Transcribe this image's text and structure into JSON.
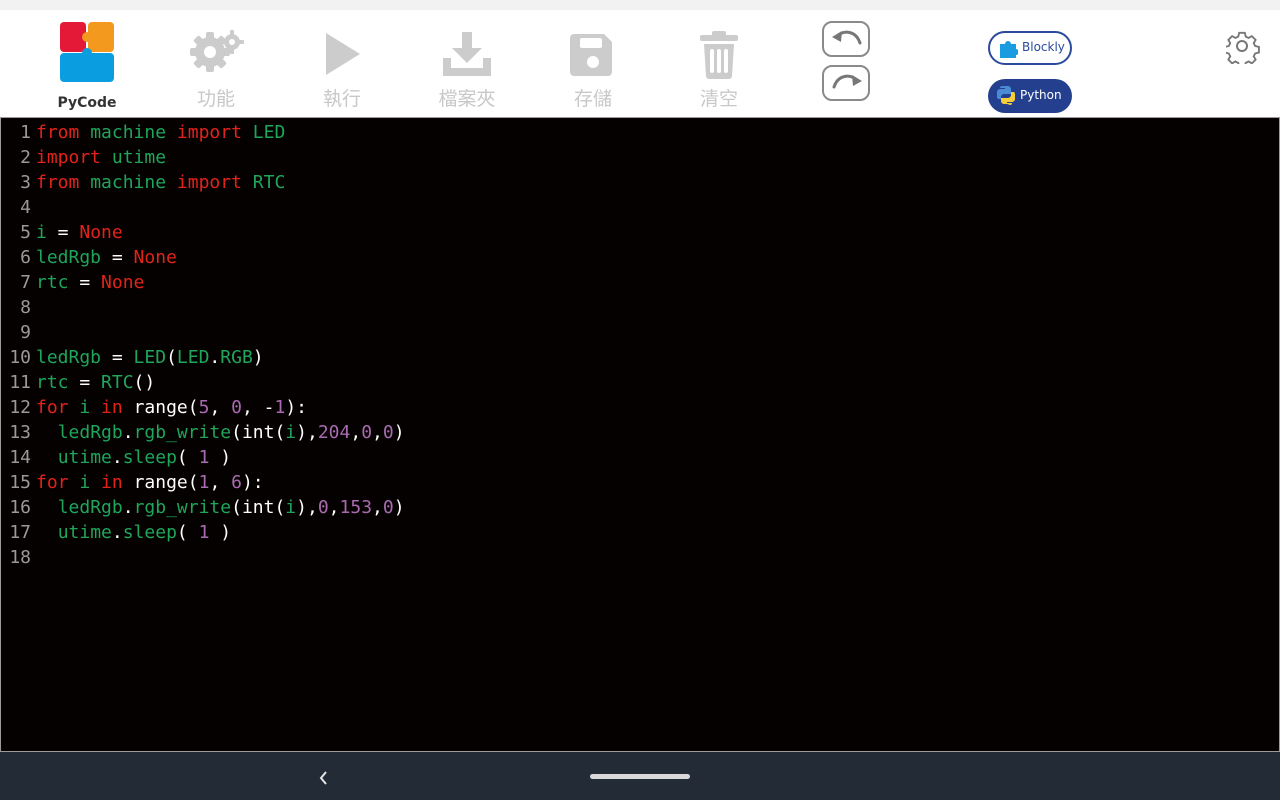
{
  "app": {
    "name": "PyCode"
  },
  "toolbar": {
    "tools": [
      {
        "label": "功能",
        "icon": "gear-icon"
      },
      {
        "label": "執行",
        "icon": "play-icon"
      },
      {
        "label": "檔案夾",
        "icon": "download-icon"
      },
      {
        "label": "存儲",
        "icon": "save-icon"
      },
      {
        "label": "清空",
        "icon": "trash-icon"
      }
    ],
    "undo_icon": "undo-icon",
    "redo_icon": "redo-icon",
    "modes": {
      "blockly_label": "Blockly",
      "python_label": "Python",
      "active": "Python"
    },
    "settings_icon": "gear-outline-icon"
  },
  "colors": {
    "editor_background": "#060101",
    "keyword": "#e2231a",
    "identifier": "#1ea65a",
    "number": "#a86ab0",
    "plain": "#ffffff",
    "line_number": "#9a9a9a",
    "mode_active": "#253f8f",
    "tool_disabled": "#c8c8c8"
  },
  "editor": {
    "lines": [
      {
        "n": "1",
        "tokens": [
          [
            "from",
            "kw"
          ],
          [
            " ",
            ""
          ],
          [
            "machine",
            "id"
          ],
          [
            " ",
            ""
          ],
          [
            "import",
            "kw"
          ],
          [
            " ",
            ""
          ],
          [
            "LED",
            "id"
          ]
        ]
      },
      {
        "n": "2",
        "tokens": [
          [
            "import",
            "kw"
          ],
          [
            " ",
            ""
          ],
          [
            "utime",
            "id"
          ]
        ]
      },
      {
        "n": "3",
        "tokens": [
          [
            "from",
            "kw"
          ],
          [
            " ",
            ""
          ],
          [
            "machine",
            "id"
          ],
          [
            " ",
            ""
          ],
          [
            "import",
            "kw"
          ],
          [
            " ",
            ""
          ],
          [
            "RTC",
            "id"
          ]
        ]
      },
      {
        "n": "4",
        "tokens": []
      },
      {
        "n": "5",
        "tokens": [
          [
            "i",
            "id"
          ],
          [
            " = ",
            ""
          ],
          [
            "None",
            "kw"
          ]
        ]
      },
      {
        "n": "6",
        "tokens": [
          [
            "ledRgb",
            "id"
          ],
          [
            " = ",
            ""
          ],
          [
            "None",
            "kw"
          ]
        ]
      },
      {
        "n": "7",
        "tokens": [
          [
            "rtc",
            "id"
          ],
          [
            " = ",
            ""
          ],
          [
            "None",
            "kw"
          ]
        ]
      },
      {
        "n": "8",
        "tokens": []
      },
      {
        "n": "9",
        "tokens": []
      },
      {
        "n": "10",
        "tokens": [
          [
            "ledRgb",
            "id"
          ],
          [
            " = ",
            ""
          ],
          [
            "LED",
            "id"
          ],
          [
            "(",
            ""
          ],
          [
            "LED",
            "id"
          ],
          [
            ".",
            ""
          ],
          [
            "RGB",
            "id"
          ],
          [
            ")",
            ""
          ]
        ]
      },
      {
        "n": "11",
        "tokens": [
          [
            "rtc",
            "id"
          ],
          [
            " = ",
            ""
          ],
          [
            "RTC",
            "id"
          ],
          [
            "()",
            ""
          ]
        ]
      },
      {
        "n": "12",
        "tokens": [
          [
            "for",
            "kw"
          ],
          [
            " ",
            ""
          ],
          [
            "i",
            "id"
          ],
          [
            " ",
            ""
          ],
          [
            "in",
            "kw"
          ],
          [
            " range(",
            ""
          ],
          [
            "5",
            "num"
          ],
          [
            ", ",
            ""
          ],
          [
            "0",
            "num"
          ],
          [
            ", -",
            ""
          ],
          [
            "1",
            "num"
          ],
          [
            "):",
            ""
          ]
        ]
      },
      {
        "n": "13",
        "tokens": [
          [
            "  ",
            ""
          ],
          [
            "ledRgb",
            "id"
          ],
          [
            ".",
            ""
          ],
          [
            "rgb_write",
            "id"
          ],
          [
            "(int(",
            ""
          ],
          [
            "i",
            "id"
          ],
          [
            "),",
            ""
          ],
          [
            "204",
            "num"
          ],
          [
            ",",
            ""
          ],
          [
            "0",
            "num"
          ],
          [
            ",",
            ""
          ],
          [
            "0",
            "num"
          ],
          [
            ")",
            ""
          ]
        ]
      },
      {
        "n": "14",
        "tokens": [
          [
            "  ",
            ""
          ],
          [
            "utime",
            "id"
          ],
          [
            ".",
            ""
          ],
          [
            "sleep",
            "id"
          ],
          [
            "( ",
            ""
          ],
          [
            "1",
            "num"
          ],
          [
            " )",
            ""
          ]
        ]
      },
      {
        "n": "15",
        "tokens": [
          [
            "for",
            "kw"
          ],
          [
            " ",
            ""
          ],
          [
            "i",
            "id"
          ],
          [
            " ",
            ""
          ],
          [
            "in",
            "kw"
          ],
          [
            " range(",
            ""
          ],
          [
            "1",
            "num"
          ],
          [
            ", ",
            ""
          ],
          [
            "6",
            "num"
          ],
          [
            "):",
            ""
          ]
        ]
      },
      {
        "n": "16",
        "tokens": [
          [
            "  ",
            ""
          ],
          [
            "ledRgb",
            "id"
          ],
          [
            ".",
            ""
          ],
          [
            "rgb_write",
            "id"
          ],
          [
            "(int(",
            ""
          ],
          [
            "i",
            "id"
          ],
          [
            "),",
            ""
          ],
          [
            "0",
            "num"
          ],
          [
            ",",
            ""
          ],
          [
            "153",
            "num"
          ],
          [
            ",",
            ""
          ],
          [
            "0",
            "num"
          ],
          [
            ")",
            ""
          ]
        ]
      },
      {
        "n": "17",
        "tokens": [
          [
            "  ",
            ""
          ],
          [
            "utime",
            "id"
          ],
          [
            ".",
            ""
          ],
          [
            "sleep",
            "id"
          ],
          [
            "( ",
            ""
          ],
          [
            "1",
            "num"
          ],
          [
            " )",
            ""
          ]
        ]
      },
      {
        "n": "18",
        "tokens": []
      }
    ]
  },
  "navbar": {
    "back_icon": "chevron-left-icon",
    "home_icon": "home-pill-icon"
  }
}
